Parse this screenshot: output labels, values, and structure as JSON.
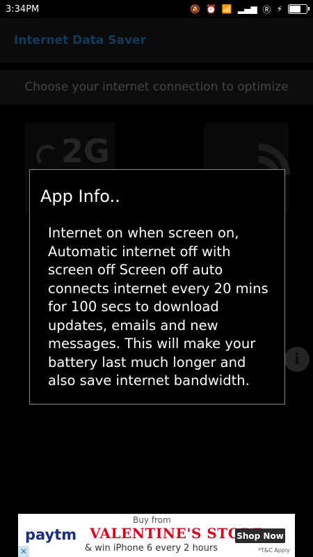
{
  "status_bar": {
    "time": "3:34PM",
    "icons": [
      "mute-icon",
      "alarm-icon",
      "wifi-icon",
      "signal-icon",
      "roaming-icon",
      "signal-icon",
      "charging-icon",
      "battery-icon"
    ]
  },
  "app_bar": {
    "title": "Internet Data Saver"
  },
  "main": {
    "prompt": "Choose your internet connection to optimize",
    "tile_2g_label": "2G",
    "accent_color": "#1e5a8a"
  },
  "dialog": {
    "title": "App Info..",
    "body": "Internet on when screen on, Automatic internet off with screen off Screen off auto connects internet every 20 mins for 100 secs to download updates, emails and new messages. This will make your battery last much longer and also save internet bandwidth."
  },
  "ad": {
    "brand": "paytm",
    "headline_small": "Buy from",
    "store": "VALENTINE'S STORE",
    "tagline": "& win iPhone 6 every 2 hours",
    "cta": "Shop Now",
    "terms": "*T&C Apply"
  }
}
